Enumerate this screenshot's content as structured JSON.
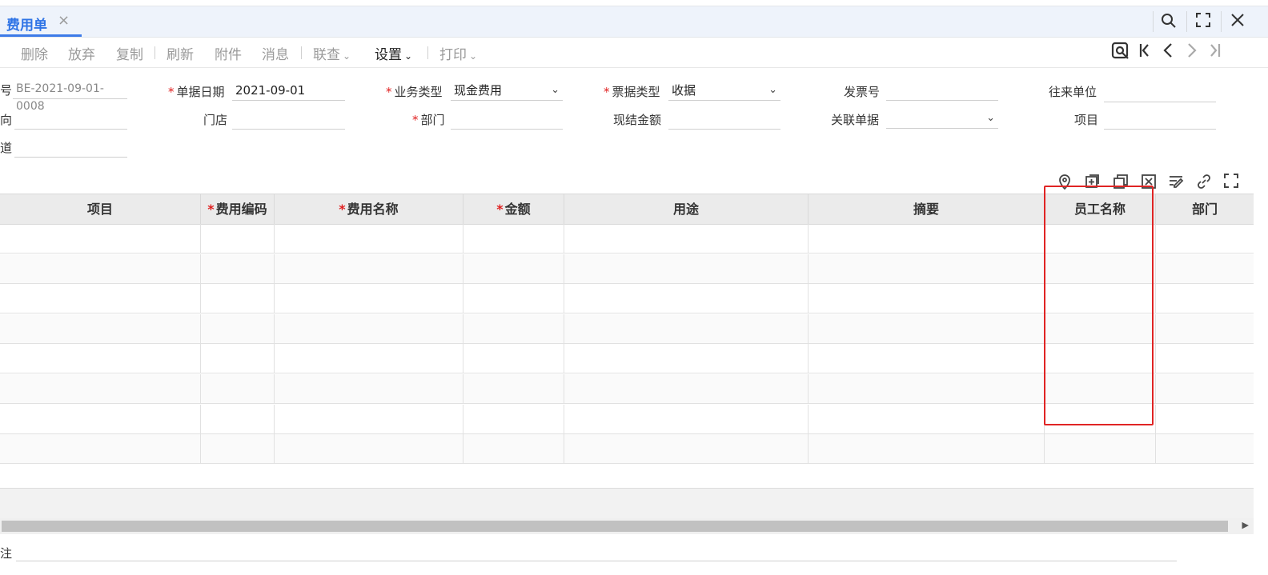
{
  "tab": {
    "title": "费用单",
    "close": "×"
  },
  "window_tools": {
    "search": "⚲",
    "maximize": "⛶",
    "close": "✕"
  },
  "toolbar": {
    "delete": "删除",
    "abandon": "放弃",
    "copy": "复制",
    "refresh": "刷新",
    "attachment": "附件",
    "message": "消息",
    "lookup": "联查",
    "settings": "设置",
    "print": "打印"
  },
  "form": {
    "doc_no": {
      "label": "号",
      "value": "BE-2021-09-01-0008"
    },
    "doc_date": {
      "label": "单据日期",
      "value": "2021-09-01"
    },
    "biz_type": {
      "label": "业务类型",
      "value": "现金费用"
    },
    "bill_type": {
      "label": "票据类型",
      "value": "收据"
    },
    "invoice_no": {
      "label": "发票号",
      "value": ""
    },
    "partner": {
      "label": "往来单位",
      "value": ""
    },
    "direction": {
      "label": "向",
      "value": ""
    },
    "store": {
      "label": "门店",
      "value": ""
    },
    "dept": {
      "label": "部门",
      "value": ""
    },
    "cash_amount": {
      "label": "现结金额",
      "value": ""
    },
    "related_doc": {
      "label": "关联单据",
      "value": ""
    },
    "project": {
      "label": "项目",
      "value": ""
    },
    "channel": {
      "label": "道",
      "value": ""
    },
    "remark": {
      "label": "注",
      "value": ""
    }
  },
  "grid": {
    "columns": [
      {
        "label": "项目",
        "required": false
      },
      {
        "label": "费用编码",
        "required": true
      },
      {
        "label": "费用名称",
        "required": true
      },
      {
        "label": "金额",
        "required": true
      },
      {
        "label": "用途",
        "required": false
      },
      {
        "label": "摘要",
        "required": false
      },
      {
        "label": "员工名称",
        "required": false
      },
      {
        "label": "部门",
        "required": false
      }
    ],
    "row_count": 8
  },
  "colors": {
    "accent": "#2f74e6",
    "required": "#e02020",
    "highlight": "#e02424"
  }
}
